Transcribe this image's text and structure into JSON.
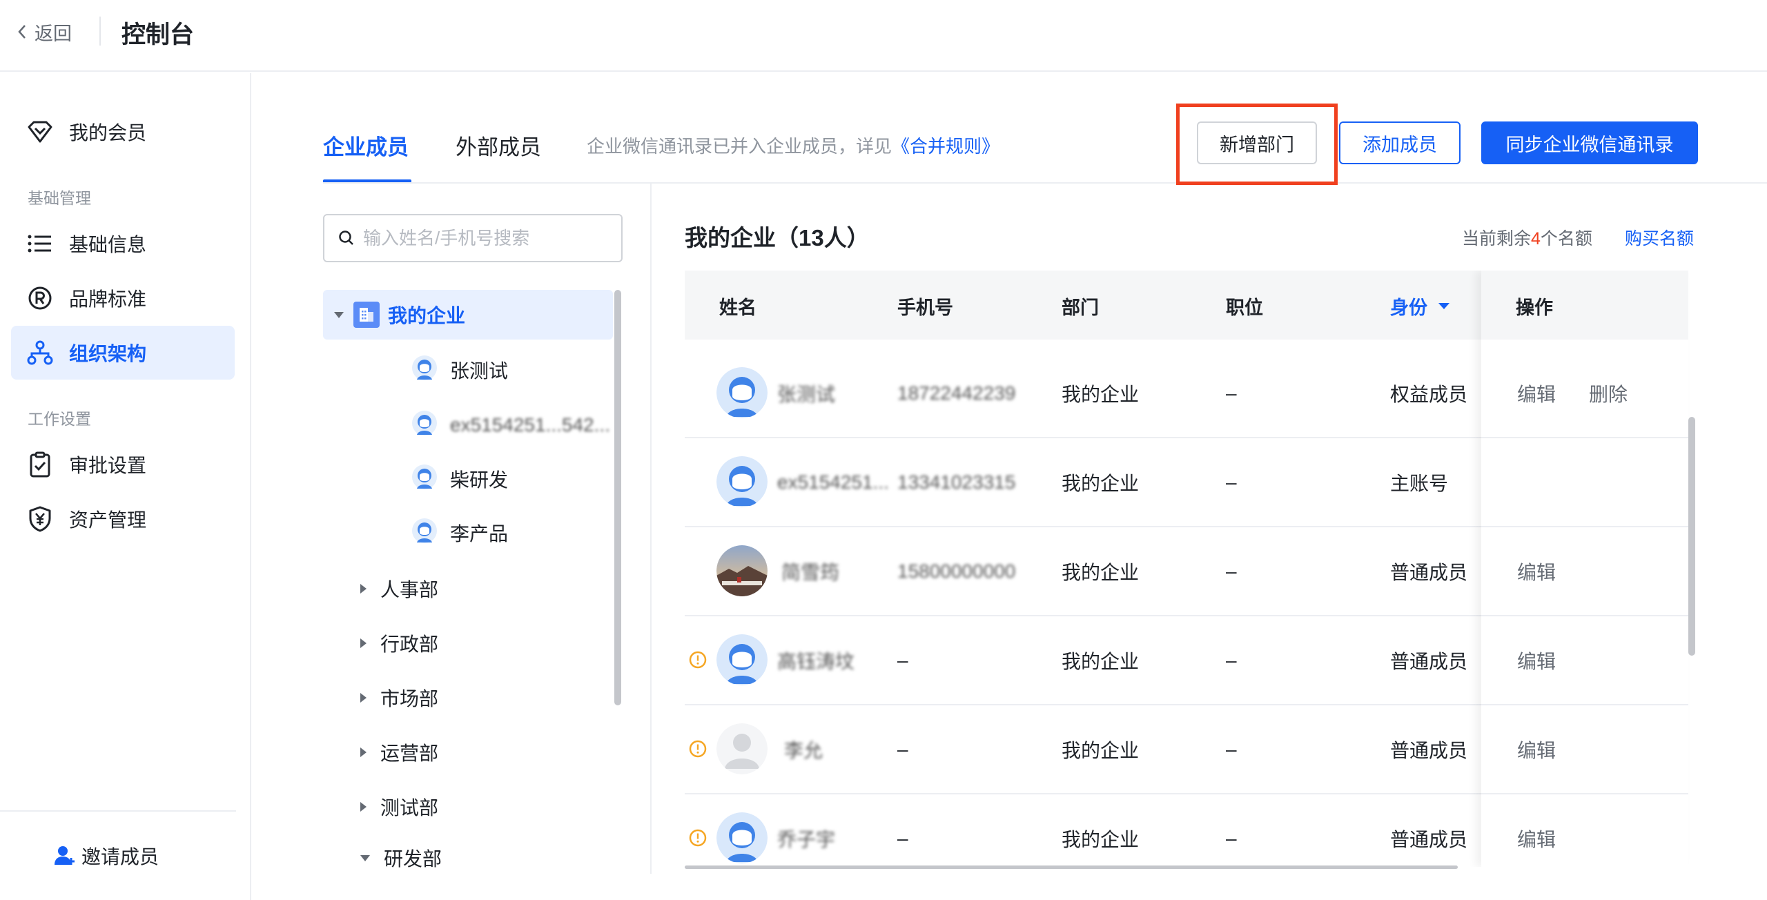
{
  "topbar": {
    "back_label": "返回",
    "title": "控制台"
  },
  "sidebar": {
    "items": [
      {
        "label": "我的会员",
        "icon": "diamond-icon"
      },
      {
        "label": "基础信息",
        "icon": "list-icon"
      },
      {
        "label": "品牌标准",
        "icon": "registered-icon"
      },
      {
        "label": "组织架构",
        "icon": "org-chart-icon",
        "active": true
      },
      {
        "label": "审批设置",
        "icon": "clipboard-check-icon"
      },
      {
        "label": "资产管理",
        "icon": "yen-shield-icon"
      }
    ],
    "sections": {
      "basic": "基础管理",
      "work": "工作设置"
    },
    "invite_label": "邀请成员"
  },
  "tabs": {
    "items": [
      {
        "label": "企业成员",
        "active": true
      },
      {
        "label": "外部成员"
      }
    ],
    "note": "企业微信通讯录已并入企业成员，详见",
    "note_link": "《合并规则》"
  },
  "actions": {
    "add_dept": "新增部门",
    "add_member": "添加成员",
    "sync_wecom": "同步企业微信通讯录"
  },
  "search": {
    "placeholder": "输入姓名/手机号搜索"
  },
  "tree": {
    "root": "我的企业",
    "members": [
      "张测试",
      "ex5154251...542...",
      "柴研发",
      "李产品"
    ],
    "departments": [
      "人事部",
      "行政部",
      "市场部",
      "运营部",
      "测试部",
      "研发部"
    ]
  },
  "org_header": {
    "title": "我的企业（13人）",
    "quota_prefix": "当前剩余",
    "quota_num": "4",
    "quota_suffix": "个名额",
    "buy_label": "购买名额"
  },
  "table": {
    "columns": [
      "姓名",
      "手机号",
      "部门",
      "职位",
      "身份",
      "操作"
    ],
    "rows": [
      {
        "name": "张测试",
        "phone": "18722442239",
        "dept": "我的企业",
        "position": "–",
        "role": "权益成员",
        "ops": [
          "编辑",
          "删除"
        ],
        "warn": false,
        "avatar": "default"
      },
      {
        "name": "ex5154251...",
        "phone": "13341023315",
        "dept": "我的企业",
        "position": "–",
        "role": "主账号",
        "ops": [],
        "warn": false,
        "avatar": "default"
      },
      {
        "name": "简雪筠",
        "phone": "15800000000",
        "dept": "我的企业",
        "position": "–",
        "role": "普通成员",
        "ops": [
          "编辑"
        ],
        "warn": false,
        "avatar": "photo"
      },
      {
        "name": "高钰涛坟",
        "phone": "–",
        "dept": "我的企业",
        "position": "–",
        "role": "普通成员",
        "ops": [
          "编辑"
        ],
        "warn": true,
        "avatar": "default"
      },
      {
        "name": "李允",
        "phone": "–",
        "dept": "我的企业",
        "position": "–",
        "role": "普通成员",
        "ops": [
          "编辑"
        ],
        "warn": true,
        "avatar": "grey"
      },
      {
        "name": "乔子宇",
        "phone": "–",
        "dept": "我的企业",
        "position": "–",
        "role": "普通成员",
        "ops": [
          "编辑"
        ],
        "warn": true,
        "avatar": "default"
      }
    ]
  },
  "colors": {
    "primary": "#1660f5",
    "highlight": "#f0401f",
    "warn": "#f5a623"
  }
}
